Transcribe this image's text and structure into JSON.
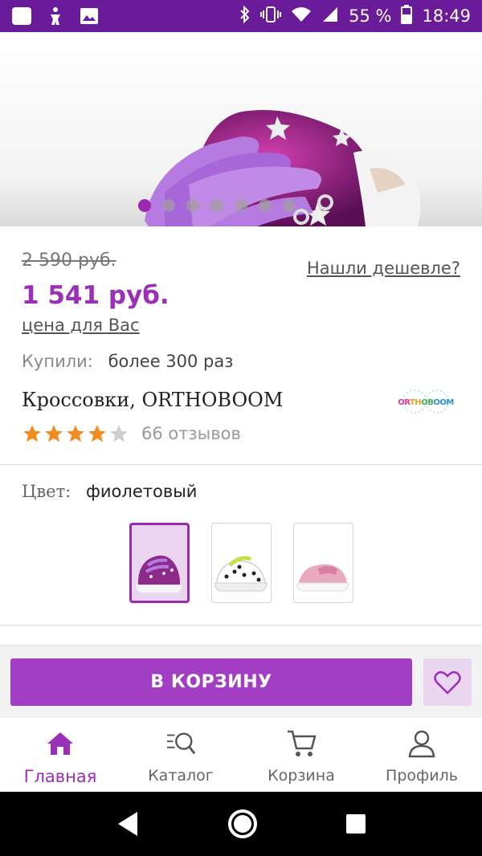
{
  "status_bar": {
    "battery": "55 %",
    "time": "18:49"
  },
  "gallery": {
    "slide_count": 7,
    "active_index": 0
  },
  "price": {
    "old": "2 590 руб.",
    "current": "1 541 руб.",
    "for_you_label": "цена для Вас",
    "cheaper_link": "Нашли дешевле?"
  },
  "purchases": {
    "label": "Купили:",
    "value": "более 300 раз"
  },
  "product": {
    "title": "Кроссовки, ORTHOBOOM",
    "brand_logo_text": "ORTHOBOOM",
    "rating": 4,
    "rating_max": 5,
    "reviews": "66 отзывов"
  },
  "color": {
    "label": "Цвет:",
    "value": "фиолетовый",
    "options": [
      "фиолетовый",
      "белый в горошек",
      "розовый"
    ],
    "selected_index": 0
  },
  "actions": {
    "add_to_cart": "В КОРЗИНУ"
  },
  "tabs": [
    {
      "label": "Главная",
      "icon": "home-icon",
      "active": true
    },
    {
      "label": "Каталог",
      "icon": "catalog-search-icon",
      "active": false
    },
    {
      "label": "Корзина",
      "icon": "cart-icon",
      "active": false
    },
    {
      "label": "Профиль",
      "icon": "profile-icon",
      "active": false
    }
  ],
  "colors": {
    "accent": "#9c2fb8",
    "status_bar": "#6a1b9a",
    "button": "#a23ec4",
    "fav_bg": "#ead6f0",
    "star": "#f28c1e"
  }
}
